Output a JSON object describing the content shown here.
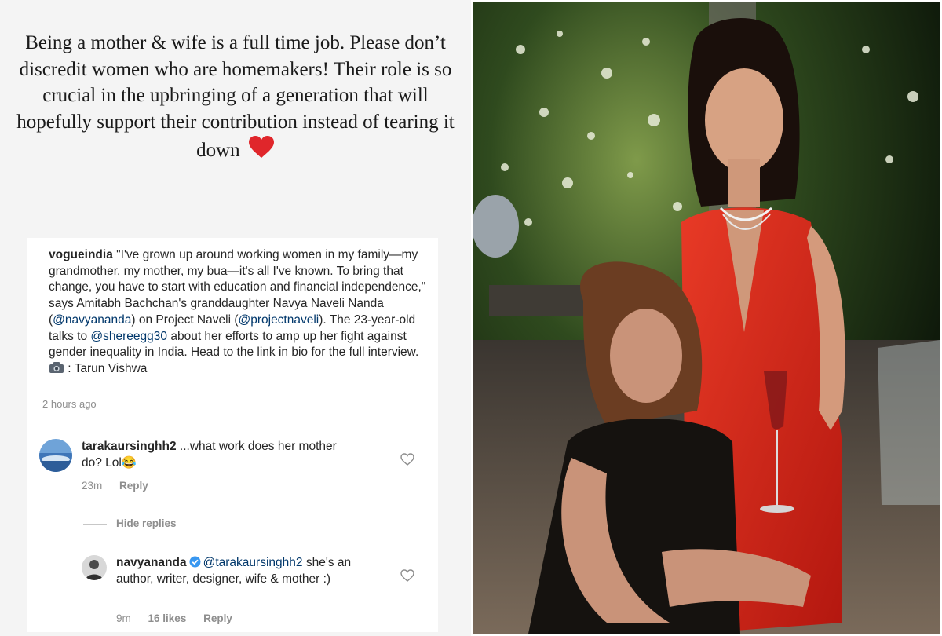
{
  "story": {
    "text": "Being a mother & wife is a full time job. Please don’t discredit women who are homemakers! Their role is so crucial in the upbringing of a generation that will hopefully support their contribution instead of tearing it down",
    "heart_color": "#e0262b"
  },
  "post": {
    "username": "vogueindia",
    "caption_part1": "\"I've grown up around working women in my family—my grandmother, my mother, my bua—it's all I've known. To bring that change, you have to start with education and financial independence,\" says Amitabh Bachchan's granddaughter Navya Naveli Nanda (",
    "mention1": "@navyananda",
    "caption_part2": ") on Project Naveli (",
    "mention2": "@projectnaveli",
    "caption_part3": "). The 23-year-old talks to ",
    "mention3": "@shereegg30",
    "caption_part4": " about her efforts to amp up her fight against gender inequality in India. Head to the link in bio for the full interview. ",
    "caption_part5": " : Tarun Vishwa",
    "time": "2 hours ago"
  },
  "comments": [
    {
      "username": "tarakaursinghh2",
      "text": " ...what work does her mother do? Lol😂",
      "time": "23m",
      "reply_label": "Reply"
    }
  ],
  "hide_replies_label": "Hide replies",
  "reply": {
    "username": "navyananda",
    "mention": "@tarakaursinghh2",
    "text": " she's an author, writer, designer, wife & mother :)",
    "time": "9m",
    "likes": "16 likes",
    "reply_label": "Reply"
  },
  "colors": {
    "link": "#00376b",
    "verified": "#3897f0",
    "dress": "#d8261c"
  },
  "icons": [
    "heart-icon",
    "camera-icon",
    "like-icon",
    "verified-icon"
  ]
}
